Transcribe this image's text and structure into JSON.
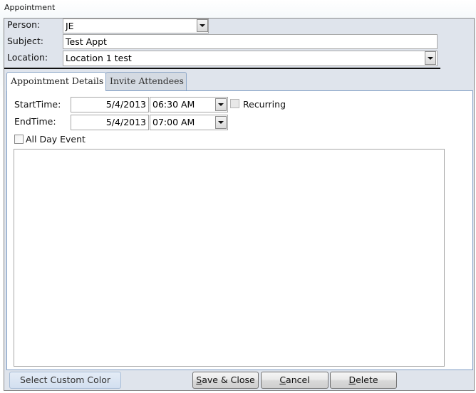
{
  "window": {
    "title": "Appointment"
  },
  "header": {
    "person": {
      "label": "Person:",
      "value": "JE"
    },
    "subject": {
      "label": "Subject:",
      "value": "Test Appt"
    },
    "location": {
      "label": "Location:",
      "value": "Location 1 test"
    }
  },
  "tabs": [
    {
      "label": "Appointment Details",
      "active": true
    },
    {
      "label": "Invite Attendees",
      "active": false
    }
  ],
  "details": {
    "start": {
      "label": "StartTime:",
      "date": "5/4/2013",
      "time": "06:30 AM"
    },
    "end": {
      "label": "EndTime:",
      "date": "5/4/2013",
      "time": "07:00 AM"
    },
    "recurring": {
      "label": "Recurring",
      "checked": false
    },
    "all_day": {
      "label": "All Day Event",
      "checked": false
    },
    "notes": ""
  },
  "footer": {
    "custom_color": "Select Custom Color",
    "save_close": {
      "mnemonic": "S",
      "rest": "ave & Close"
    },
    "cancel": {
      "mnemonic": "C",
      "rest": "ancel"
    },
    "delete": {
      "mnemonic": "D",
      "rest": "elete"
    }
  }
}
